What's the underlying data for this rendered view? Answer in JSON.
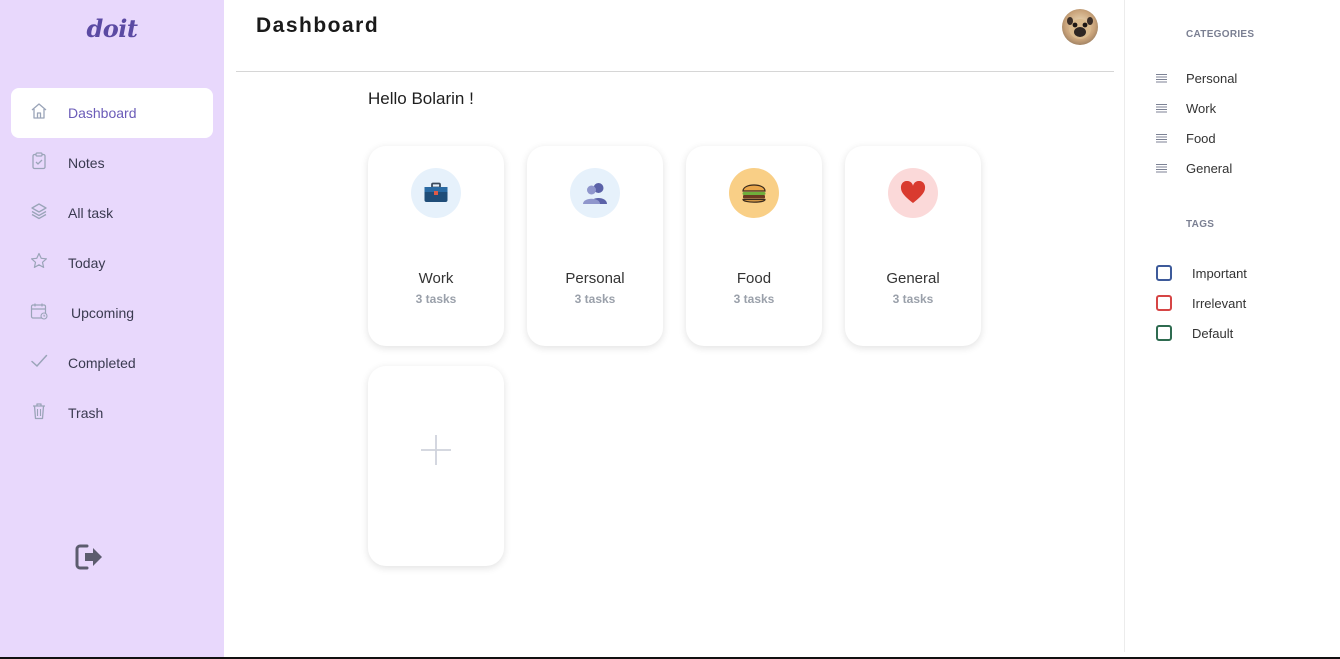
{
  "app": {
    "logo": "doit"
  },
  "sidebar": {
    "items": [
      {
        "label": "Dashboard",
        "icon": "home-icon",
        "active": true
      },
      {
        "label": "Notes",
        "icon": "clipboard-icon",
        "active": false
      },
      {
        "label": "All task",
        "icon": "layers-icon",
        "active": false
      },
      {
        "label": "Today",
        "icon": "star-icon",
        "active": false
      },
      {
        "label": "Upcoming",
        "icon": "calendar-icon",
        "active": false
      },
      {
        "label": "Completed",
        "icon": "check-icon",
        "active": false
      },
      {
        "label": "Trash",
        "icon": "trash-icon",
        "active": false
      }
    ],
    "logout_icon": "logout-icon"
  },
  "header": {
    "title": "Dashboard",
    "avatar_icon": "avatar"
  },
  "main": {
    "greeting": "Hello Bolarin !",
    "cards": [
      {
        "title": "Work",
        "count": "3 tasks",
        "icon": "briefcase-icon",
        "bg": "#e6f1fb"
      },
      {
        "title": "Personal",
        "count": "3 tasks",
        "icon": "people-icon",
        "bg": "#e6f1fb"
      },
      {
        "title": "Food",
        "count": "3 tasks",
        "icon": "burger-icon",
        "bg": "#f9cf86"
      },
      {
        "title": "General",
        "count": "3 tasks",
        "icon": "heart-icon",
        "bg": "#fbd9d9"
      }
    ],
    "add_card_icon": "plus-icon"
  },
  "right_panel": {
    "categories_heading": "CATEGORIES",
    "categories": [
      "Personal",
      "Work",
      "Food",
      "General"
    ],
    "tags_heading": "TAGS",
    "tags": [
      {
        "label": "Important",
        "color": "#3d5a9a"
      },
      {
        "label": "Irrelevant",
        "color": "#d64545"
      },
      {
        "label": "Default",
        "color": "#2e6b50"
      }
    ]
  },
  "colors": {
    "sidebar_bg": "#e8d8fc",
    "accent": "#6b5cb8"
  }
}
